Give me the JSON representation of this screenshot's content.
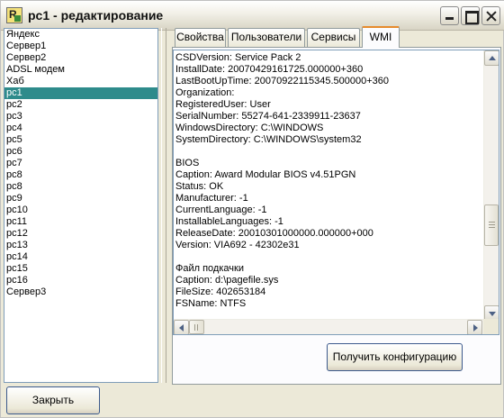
{
  "window": {
    "title": "pc1 - редактирование"
  },
  "hosts": [
    "Яндекс",
    "Сервер1",
    "Сервер2",
    "ADSL модем",
    "Хаб",
    "pc1",
    "pc2",
    "pc3",
    "pc4",
    "pc5",
    "pc6",
    "pc7",
    "pc8",
    "pc8",
    "pc9",
    "pc10",
    "pc11",
    "pc12",
    "pc13",
    "pc14",
    "pc15",
    "pc16",
    "Сервер3"
  ],
  "selected_host": "pc1",
  "tabs": [
    {
      "label": "Свойства",
      "active": false
    },
    {
      "label": "Пользователи",
      "active": false
    },
    {
      "label": "Сервисы",
      "active": false
    },
    {
      "label": "WMI",
      "active": true
    }
  ],
  "wmi_lines": [
    "CSDVersion: Service Pack 2",
    "InstallDate: 20070429161725.000000+360",
    "LastBootUpTime: 20070922115345.500000+360",
    "Organization:",
    "RegisteredUser: User",
    "SerialNumber: 55274-641-2339911-23637",
    "WindowsDirectory: C:\\WINDOWS",
    "SystemDirectory: C:\\WINDOWS\\system32",
    "",
    "BIOS",
    "Caption: Award Modular BIOS v4.51PGN",
    "Status: OK",
    "Manufacturer: -1",
    "CurrentLanguage: -1",
    "InstallableLanguages: -1",
    "ReleaseDate: 20010301000000.000000+000",
    "Version: VIA692 - 42302e31",
    "",
    "Файл подкачки",
    "Caption: d:\\pagefile.sys",
    "FileSize: 402653184",
    "FSName: NTFS"
  ],
  "buttons": {
    "get_config": "Получить конфигурацию",
    "close": "Закрыть"
  },
  "colors": {
    "selection": "#2e8b8b",
    "active_tab_accent": "#e68b2c"
  },
  "icons": {
    "app": "app-icon",
    "minimize": "minimize-icon",
    "maximize": "maximize-icon",
    "close": "close-icon"
  }
}
